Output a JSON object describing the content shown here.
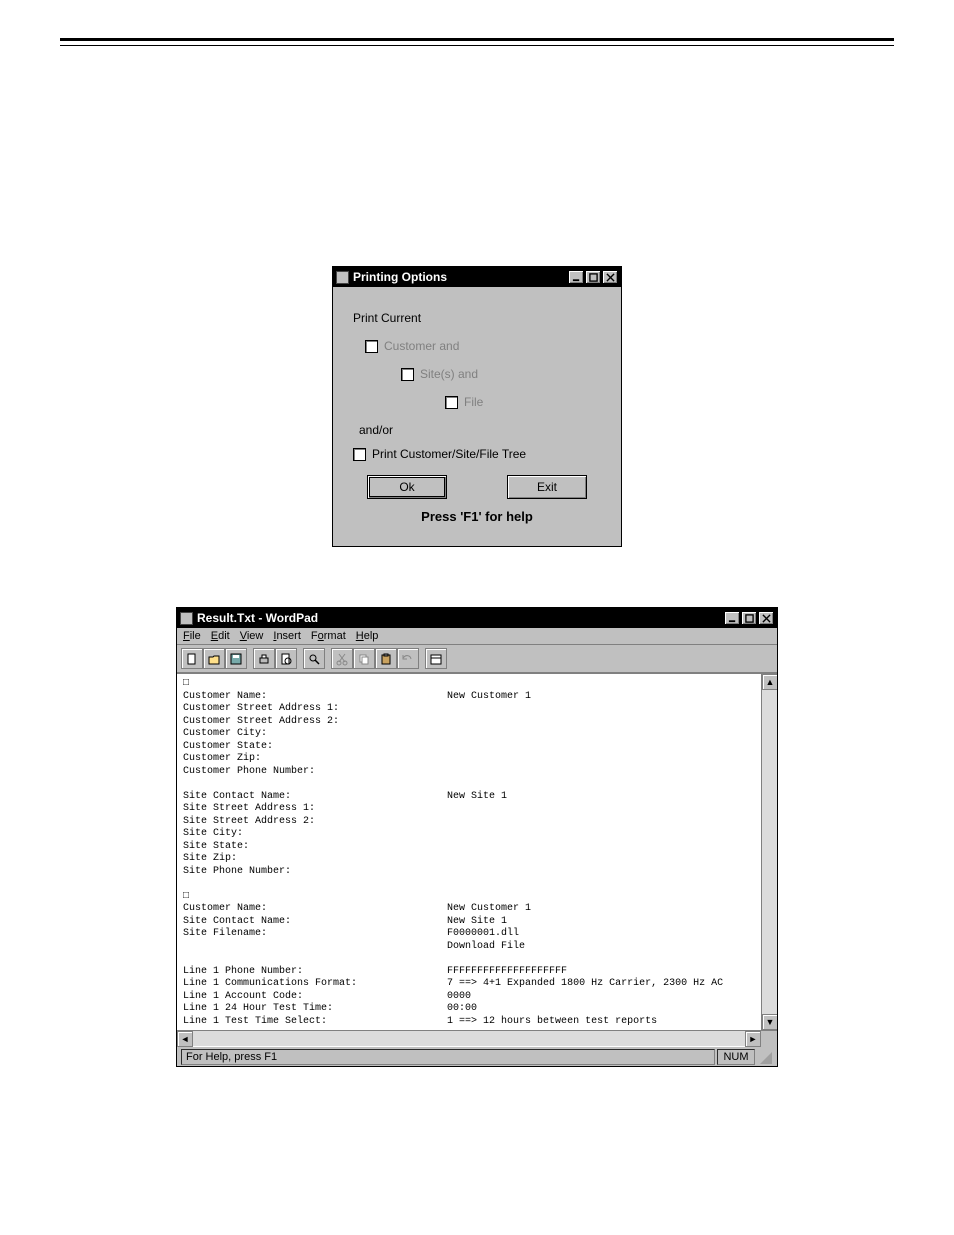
{
  "dialog1": {
    "title": "Printing Options",
    "print_current": "Print Current",
    "customer_and": "Customer and",
    "sites_and": "Site(s) and",
    "file": "File",
    "andor": "and/or",
    "print_tree": "Print Customer/Site/File Tree",
    "ok": "Ok",
    "exit": "Exit",
    "help": "Press 'F1' for help"
  },
  "wordpad": {
    "title": "Result.Txt - WordPad",
    "menu": {
      "file": "File",
      "edit": "Edit",
      "view": "View",
      "insert": "Insert",
      "format": "Format",
      "help": "Help"
    },
    "status": "For Help, press F1",
    "num": "NUM",
    "doc_records": [
      {
        "fields": [
          [
            "Customer Name:",
            "New Customer 1"
          ],
          [
            "Customer Street Address 1:",
            ""
          ],
          [
            "Customer Street Address 2:",
            ""
          ],
          [
            "Customer City:",
            ""
          ],
          [
            "Customer State:",
            ""
          ],
          [
            "Customer Zip:",
            ""
          ],
          [
            "Customer Phone Number:",
            ""
          ]
        ]
      },
      {
        "fields": [
          [
            "Site Contact Name:",
            "New Site 1"
          ],
          [
            "Site Street Address 1:",
            ""
          ],
          [
            "Site Street Address 2:",
            ""
          ],
          [
            "Site City:",
            ""
          ],
          [
            "Site State:",
            ""
          ],
          [
            "Site Zip:",
            ""
          ],
          [
            "Site Phone Number:",
            ""
          ]
        ]
      },
      {
        "fields": [
          [
            "Customer Name:",
            "New Customer 1"
          ],
          [
            "Site Contact Name:",
            "New Site 1"
          ],
          [
            "Site Filename:",
            "F0000001.dll"
          ],
          [
            "",
            "Download File"
          ]
        ]
      },
      {
        "fields": [
          [
            "Line 1 Phone Number:",
            "FFFFFFFFFFFFFFFFFFFF"
          ],
          [
            "Line 1 Communications Format:",
            "7 ==> 4+1 Expanded 1800 Hz Carrier, 2300 Hz AC"
          ],
          [
            "Line 1 Account Code:",
            "0000"
          ],
          [
            "Line 1 24 Hour Test Time:",
            "00:00"
          ],
          [
            "Line 1 Test Time Select:",
            "1 ==> 12 hours between test reports"
          ]
        ]
      }
    ]
  }
}
